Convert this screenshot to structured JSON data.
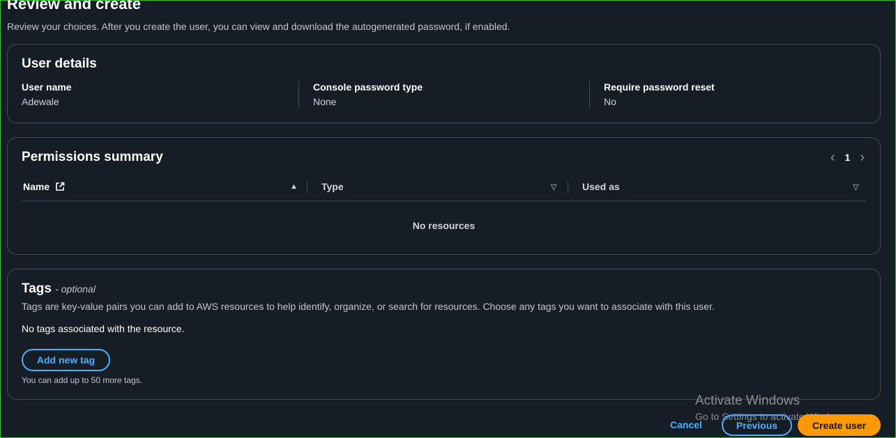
{
  "header": {
    "title": "Review and create",
    "description": "Review your choices. After you create the user, you can view and download the autogenerated password, if enabled."
  },
  "user_details": {
    "title": "User details",
    "fields": [
      {
        "label": "User name",
        "value": "Adewale"
      },
      {
        "label": "Console password type",
        "value": "None"
      },
      {
        "label": "Require password reset",
        "value": "No"
      }
    ]
  },
  "permissions": {
    "title": "Permissions summary",
    "page": "1",
    "columns": [
      "Name",
      "Type",
      "Used as"
    ],
    "empty_text": "No resources"
  },
  "tags": {
    "title": "Tags",
    "optional": "- optional",
    "description": "Tags are key-value pairs you can add to AWS resources to help identify, organize, or search for resources. Choose any tags you want to associate with this user.",
    "empty_text": "No tags associated with the resource.",
    "add_button": "Add new tag",
    "hint": "You can add up to 50 more tags."
  },
  "footer": {
    "cancel": "Cancel",
    "previous": "Previous",
    "create": "Create user"
  },
  "watermark": {
    "title": "Activate Windows",
    "subtitle": "Go to Settings to activate Windows."
  },
  "colors": {
    "background": "#161d26",
    "accent_link": "#42b4ff",
    "primary_button": "#ff9900",
    "border": "#414d5c"
  }
}
